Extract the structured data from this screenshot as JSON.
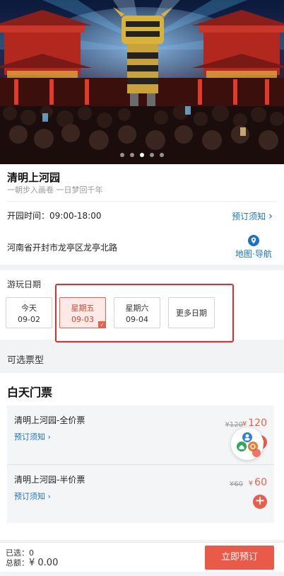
{
  "hero": {
    "dots_total": 5,
    "dots_active_index": 2
  },
  "attraction": {
    "title": "清明上河园",
    "subtitle": "一朝步入画卷 一日梦回千年",
    "hours": "开园时间：09:00-18:00",
    "notice_link": "预订须知",
    "notice_chevron": "›",
    "address": "河南省开封市龙亭区龙亭北路",
    "map_nav_label": "地图·导航"
  },
  "date_picker": {
    "label": "游玩日期",
    "dates": [
      {
        "weekday": "今天",
        "date": "09-02",
        "selected": false
      },
      {
        "weekday": "星期五",
        "date": "09-03",
        "selected": true
      },
      {
        "weekday": "星期六",
        "date": "09-04",
        "selected": false
      }
    ],
    "more_label": "更多日期",
    "check_glyph": "✓"
  },
  "ticket_types": {
    "section_label": "可选票型",
    "category_title": "白天门票",
    "tickets": [
      {
        "name": "清明上河园-全价票",
        "notice": "预订须知 ›",
        "original_price": "¥120",
        "currency": "¥",
        "price": "120"
      },
      {
        "name": "清明上河园-半价票",
        "notice": "预订须知 ›",
        "original_price": "¥60",
        "currency": "¥",
        "price": "60"
      }
    ],
    "add_glyph": "+"
  },
  "footer": {
    "selected": "已选：0",
    "total_label": "总额：",
    "total_amount": "¥ 0.00",
    "book_button": "立即预订"
  },
  "colors": {
    "accent": "#e8604c",
    "link": "#1a73c9",
    "frame": "#e52c2c"
  },
  "icons": [
    "map-pin-icon",
    "chevron-right-icon",
    "check-icon",
    "plus-icon",
    "assistant-icon"
  ]
}
